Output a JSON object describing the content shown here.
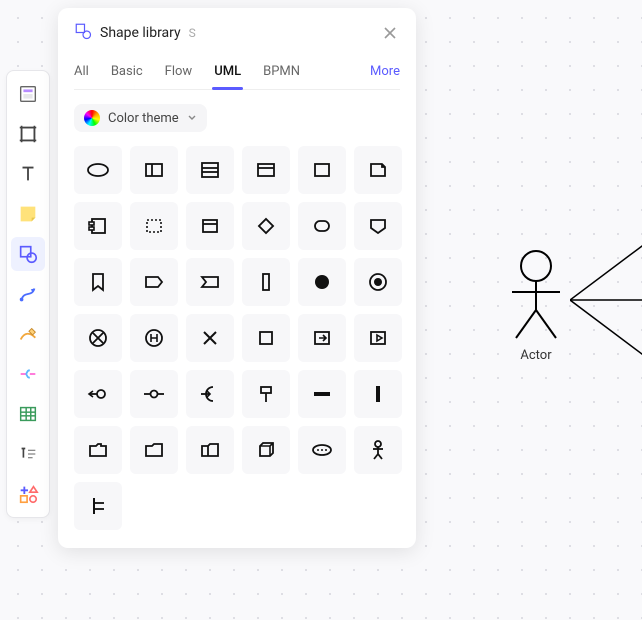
{
  "panel": {
    "title": "Shape library",
    "shortcut": "S",
    "tabs": [
      "All",
      "Basic",
      "Flow",
      "UML",
      "BPMN"
    ],
    "active_tab": "UML",
    "more": "More",
    "color_theme_label": "Color theme"
  },
  "canvas": {
    "actor_label": "Actor"
  },
  "toolbar": {
    "items": [
      "template",
      "frame",
      "text",
      "sticky-note",
      "shape",
      "connector",
      "pen",
      "mindmap",
      "table",
      "text-block",
      "more-shapes"
    ],
    "active": "shape"
  },
  "shapes": [
    "ellipse",
    "class",
    "table",
    "package",
    "rect",
    "note",
    "component",
    "dotted-rect",
    "interface",
    "decision",
    "state",
    "shield",
    "bookmark",
    "send-signal",
    "receive-signal",
    "bar-vert",
    "filled-circle",
    "ring-circle",
    "x-circle",
    "h-circle",
    "x-mark",
    "square",
    "exit",
    "arrow-box",
    "fork-left",
    "fork-node",
    "merge",
    "pin",
    "bar-horiz",
    "bar-thin-vert",
    "folder",
    "folder2",
    "folder-panel",
    "cube",
    "ellipsis",
    "actor",
    "assoc"
  ]
}
